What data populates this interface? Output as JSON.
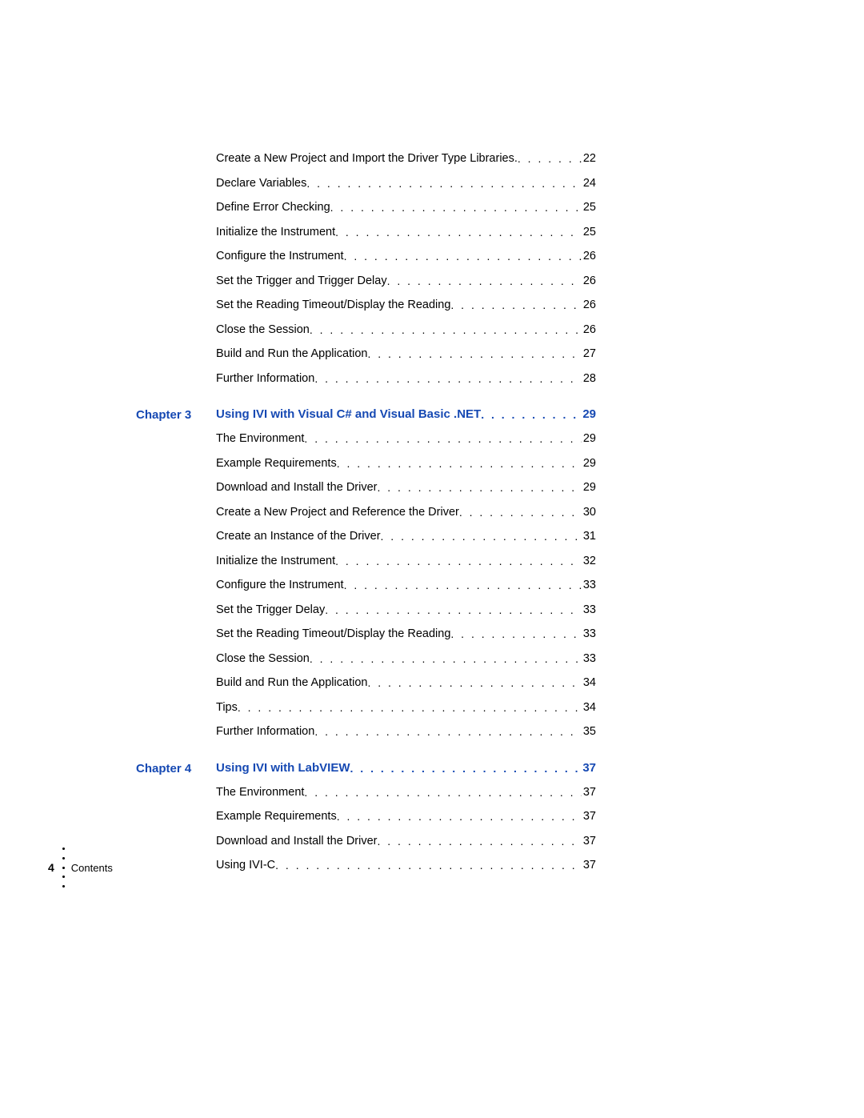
{
  "footer": {
    "page_number": "4",
    "label": "Contents"
  },
  "sections": [
    {
      "chapter_label": "",
      "heading": null,
      "entries": [
        {
          "title": "Create a New Project and Import the Driver Type Libraries",
          "sep": ".",
          "page": "22"
        },
        {
          "title": "Declare Variables",
          "sep": "",
          "page": "24"
        },
        {
          "title": "Define Error Checking",
          "sep": "",
          "page": "25"
        },
        {
          "title": "Initialize the Instrument",
          "sep": "",
          "page": "25"
        },
        {
          "title": "Configure the Instrument",
          "sep": "",
          "page": "26"
        },
        {
          "title": "Set the Trigger and Trigger Delay",
          "sep": "",
          "page": "26"
        },
        {
          "title": "Set the Reading Timeout/Display the Reading",
          "sep": "",
          "page": "26"
        },
        {
          "title": "Close the Session",
          "sep": "",
          "page": "26"
        },
        {
          "title": "Build and Run the Application",
          "sep": "",
          "page": "27"
        },
        {
          "title": "Further Information",
          "sep": "",
          "page": "28"
        }
      ]
    },
    {
      "chapter_label": "Chapter 3",
      "heading": {
        "title": "Using IVI with Visual C# and Visual Basic .NET",
        "page": "29"
      },
      "entries": [
        {
          "title": "The Environment",
          "sep": "",
          "page": "29"
        },
        {
          "title": "Example Requirements",
          "sep": "",
          "page": "29"
        },
        {
          "title": "Download and Install the Driver",
          "sep": "",
          "page": "29"
        },
        {
          "title": "Create a New Project and Reference the Driver",
          "sep": "",
          "page": "30"
        },
        {
          "title": "Create an Instance of the Driver",
          "sep": "",
          "page": "31"
        },
        {
          "title": "Initialize the Instrument",
          "sep": "",
          "page": "32"
        },
        {
          "title": "Configure the Instrument",
          "sep": "",
          "page": "33"
        },
        {
          "title": "Set the Trigger Delay",
          "sep": "",
          "page": "33"
        },
        {
          "title": "Set the Reading Timeout/Display the Reading",
          "sep": "",
          "page": "33"
        },
        {
          "title": "Close the Session",
          "sep": "",
          "page": "33"
        },
        {
          "title": "Build and Run the Application",
          "sep": "",
          "page": "34"
        },
        {
          "title": "Tips",
          "sep": "",
          "page": "34"
        },
        {
          "title": "Further Information",
          "sep": "",
          "page": "35"
        }
      ]
    },
    {
      "chapter_label": "Chapter 4",
      "heading": {
        "title": "Using IVI with LabVIEW",
        "page": "37"
      },
      "entries": [
        {
          "title": "The Environment",
          "sep": "",
          "page": "37"
        },
        {
          "title": "Example Requirements",
          "sep": "",
          "page": "37"
        },
        {
          "title": "Download and Install the Driver",
          "sep": "",
          "page": "37"
        },
        {
          "title": "Using IVI-C",
          "sep": "",
          "page": "37"
        }
      ]
    }
  ]
}
